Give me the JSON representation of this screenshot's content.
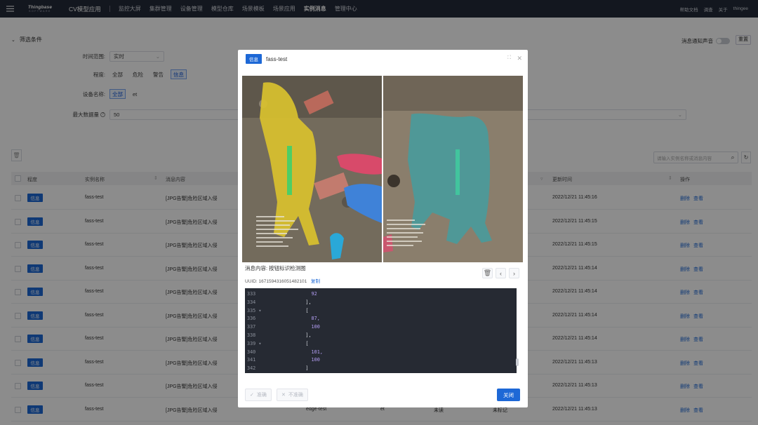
{
  "topbar": {
    "logo_main": "Thingbase",
    "logo_sub": "SOFTWARE",
    "app_title": "CV模型应用",
    "nav": [
      "监控大屏",
      "集群管理",
      "设备管理",
      "模型仓库",
      "场景模板",
      "场景应用",
      "实例消息",
      "管理中心"
    ],
    "active_nav": "实例消息",
    "right": [
      "帮助文档",
      "调查",
      "关于",
      "thingee"
    ]
  },
  "filter": {
    "section_title": "筛选条件",
    "notify_label": "消息通知声音",
    "reset_label": "重置",
    "time_label": "时间范围:",
    "time_value": "实时",
    "level_label": "程度:",
    "levels": [
      "全部",
      "危险",
      "警告",
      "信息"
    ],
    "level_selected": "信息",
    "device_label": "设备名称:",
    "devices": [
      "全部",
      "et"
    ],
    "device_selected": "全部",
    "max_label": "最大数据量",
    "max_value": "50"
  },
  "search": {
    "placeholder": "请输入实例名称或消息内容"
  },
  "table": {
    "headers": {
      "level": "程度",
      "name": "实例名称",
      "content": "消息内容",
      "update_time": "更新时间",
      "ops": "操作"
    },
    "rows": [
      {
        "badge": "信息",
        "name": "fass-test",
        "content": "[JPG告警]危险区域入侵",
        "time": "2022/12/21 11:45:16",
        "del": "删除",
        "view": "查看"
      },
      {
        "badge": "信息",
        "name": "fass-test",
        "content": "[JPG告警]危险区域入侵",
        "time": "2022/12/21 11:45:15",
        "del": "删除",
        "view": "查看"
      },
      {
        "badge": "信息",
        "name": "fass-test",
        "content": "[JPG告警]危险区域入侵",
        "time": "2022/12/21 11:45:15",
        "del": "删除",
        "view": "查看"
      },
      {
        "badge": "信息",
        "name": "fass-test",
        "content": "[JPG告警]危险区域入侵",
        "time": "2022/12/21 11:45:14",
        "del": "删除",
        "view": "查看"
      },
      {
        "badge": "信息",
        "name": "fass-test",
        "content": "[JPG告警]危险区域入侵",
        "time": "2022/12/21 11:45:14",
        "del": "删除",
        "view": "查看"
      },
      {
        "badge": "信息",
        "name": "fass-test",
        "content": "[JPG告警]危险区域入侵",
        "time": "2022/12/21 11:45:14",
        "del": "删除",
        "view": "查看"
      },
      {
        "badge": "信息",
        "name": "fass-test",
        "content": "[JPG告警]危险区域入侵",
        "time": "2022/12/21 11:45:14",
        "del": "删除",
        "view": "查看"
      },
      {
        "badge": "信息",
        "name": "fass-test",
        "content": "[JPG告警]危险区域入侵",
        "time": "2022/12/21 11:45:13",
        "del": "删除",
        "view": "查看"
      },
      {
        "badge": "信息",
        "name": "fass-test",
        "content": "[JPG告警]危险区域入侵",
        "time": "2022/12/21 11:45:13",
        "del": "删除",
        "view": "查看"
      },
      {
        "badge": "信息",
        "name": "fass-test",
        "content": "[JPG告警]危险区域入侵",
        "time": "2022/12/21 11:45:13",
        "del": "删除",
        "view": "查看",
        "extra_name": "edge-test",
        "extra_device": "et",
        "extra_s1": "未读",
        "extra_s2": "未标记"
      }
    ]
  },
  "modal": {
    "badge": "信息",
    "title": "fass-test",
    "message": "消息内容: 按钮标识检测图",
    "uuid_label": "UUID:",
    "uuid": "1671594316051482101",
    "copy": "复制",
    "code_lines": [
      {
        "n": "333",
        "t": "      92",
        "num": true
      },
      {
        "n": "334",
        "t": "    ],"
      },
      {
        "n": "335 ▾",
        "t": "    ["
      },
      {
        "n": "336",
        "t": "      87,",
        "num": true
      },
      {
        "n": "337",
        "t": "      100",
        "num": true
      },
      {
        "n": "338",
        "t": "    ],"
      },
      {
        "n": "339 ▾",
        "t": "    ["
      },
      {
        "n": "340",
        "t": "      101,",
        "num": true
      },
      {
        "n": "341",
        "t": "      100",
        "num": true
      },
      {
        "n": "342",
        "t": "    ]"
      }
    ],
    "accurate": "准确",
    "inaccurate": "不准确",
    "close": "关闭"
  }
}
